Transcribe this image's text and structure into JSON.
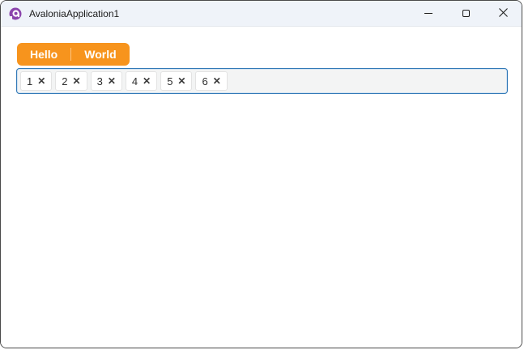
{
  "window": {
    "title": "AvaloniaApplication1",
    "app_icon": "avalonia-logo-icon",
    "controls": [
      {
        "label": "minimize",
        "icon": "minimize-icon"
      },
      {
        "label": "maximize",
        "icon": "maximize-icon"
      },
      {
        "label": "close",
        "icon": "close-icon"
      }
    ]
  },
  "split_button": {
    "primary_label": "Hello",
    "secondary_label": "World",
    "background_color": "#F7941D",
    "text_color": "#FFFFFF"
  },
  "tag_box": {
    "border_color": "#3279B7",
    "background_color": "#F3F4F4",
    "remove_glyph": "✕",
    "tags": [
      {
        "label": "1"
      },
      {
        "label": "2"
      },
      {
        "label": "3"
      },
      {
        "label": "4"
      },
      {
        "label": "5"
      },
      {
        "label": "6"
      }
    ]
  },
  "colors": {
    "titlebar_background": "#EFF3F9",
    "window_border": "#4A4A4A",
    "content_background": "#FFFFFF",
    "avalonia_purple": "#8B44AC"
  }
}
